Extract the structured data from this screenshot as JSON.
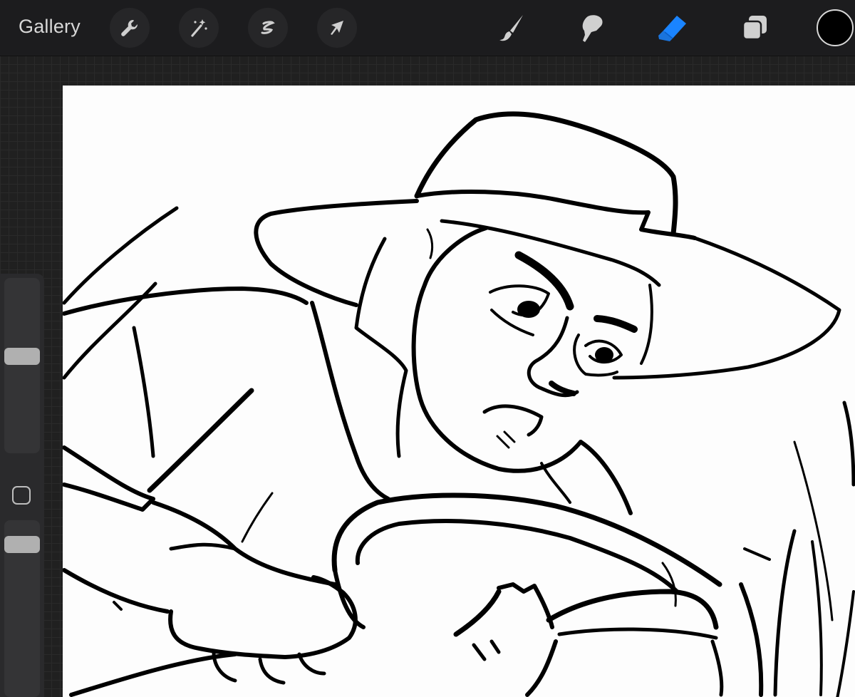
{
  "toolbar": {
    "gallery_label": "Gallery",
    "actions": [
      {
        "name": "actions-button",
        "icon": "wrench-icon"
      },
      {
        "name": "adjustments-button",
        "icon": "magic-wand-icon"
      },
      {
        "name": "selection-button",
        "icon": "selection-s-icon"
      },
      {
        "name": "transform-button",
        "icon": "arrow-icon"
      }
    ],
    "tools": [
      {
        "name": "brush-tool",
        "icon": "brush-icon",
        "active": false
      },
      {
        "name": "smudge-tool",
        "icon": "smudge-icon",
        "active": false
      },
      {
        "name": "eraser-tool",
        "icon": "eraser-icon",
        "active": true
      },
      {
        "name": "layers-button",
        "icon": "layers-icon",
        "active": false
      }
    ],
    "current_color": "#000000"
  },
  "colors": {
    "toolbar_bg": "#1c1c1e",
    "active_tool": "#1a84ff",
    "inactive_tool": "#d0d0d0",
    "canvas_bg": "#fdfdfd"
  },
  "sidebar": {
    "brush_size_value": 0.56,
    "opacity_value": 0.9
  }
}
